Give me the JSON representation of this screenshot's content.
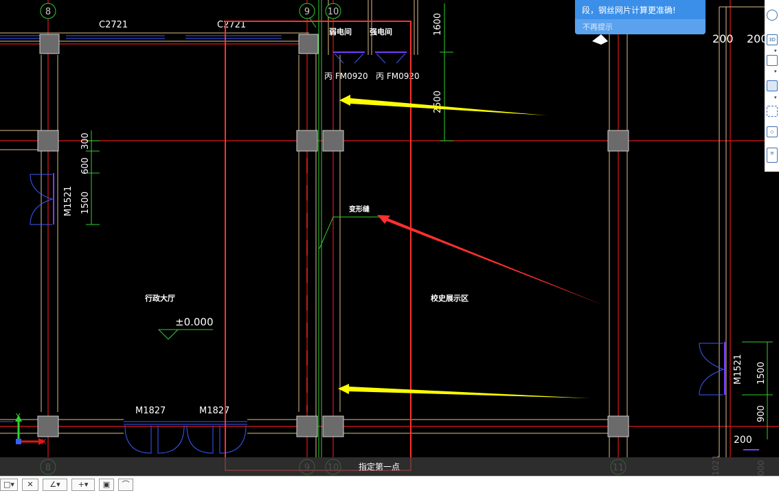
{
  "notice": {
    "message": "段，钢丝网片计算更准确!",
    "dismiss_label": "不再提示"
  },
  "axes": {
    "top": [
      "8",
      "9",
      "10"
    ],
    "bottom": [
      "8",
      "9",
      "10",
      "11"
    ]
  },
  "labels": {
    "window_1": "C2721",
    "window_2": "C2721",
    "room_weak": "弱电间",
    "room_strong": "强电间",
    "fire_door_1": "丙 FM0920",
    "fire_door_2": "丙 FM0920",
    "dim_1600": "1600",
    "dim_2500": "2500",
    "dim_300": "300",
    "dim_600": "600",
    "dim_1500_left": "1500",
    "door_m1521_left": "M1521",
    "joint_label": "变形缝",
    "hall_label": "行政大厅",
    "exhibit_label": "校史展示区",
    "elevation": "±0.000",
    "door_m1827_1": "M1827",
    "door_m1827_2": "M1827",
    "door_m1521_right": "M1521",
    "dim_1500_right": "1500",
    "dim_900": "900",
    "dim_200_a": "200",
    "dim_200_b": "200",
    "dim_200_c": "200",
    "dim_1021": "1021",
    "dim_000": "000",
    "ucs_y": "Y",
    "ucs_x": "X"
  },
  "status": {
    "command_prompt": "指定第一点"
  },
  "toolbar": {
    "right_3d": "3D"
  },
  "colors": {
    "background": "#000000",
    "axis_red": "#e01818",
    "wall_tan": "#e0c08a",
    "column_gray": "#6b6b6b",
    "door_purple": "#7a3cff",
    "window_blue": "#3a5cff",
    "dim_green": "#2fd02f",
    "highlight_red": "#ff3030",
    "arrow_yellow": "#ffff00",
    "notice_blue": "#3b8fe8"
  }
}
